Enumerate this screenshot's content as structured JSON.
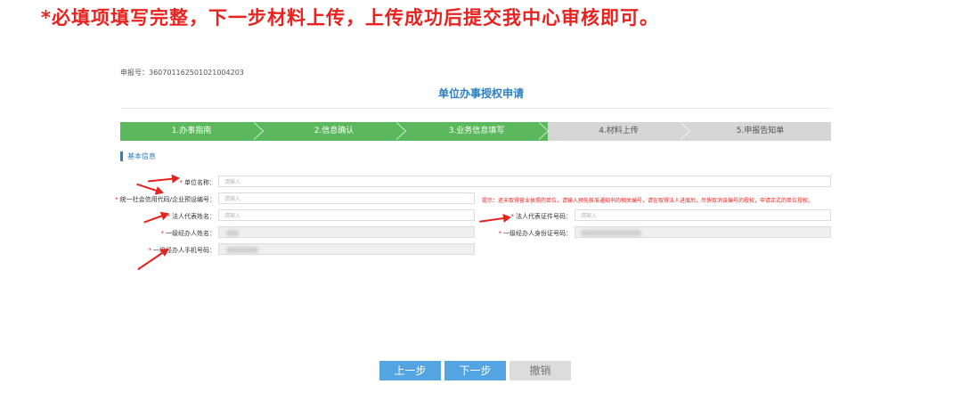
{
  "banner": "*必填项填写完整，下一步材料上传，上传成功后提交我中心审核即可。",
  "application_number": "申报号：36070116250102100420​3",
  "page_title": "单位办事授权申请",
  "steps": [
    {
      "label": "1.办事指南",
      "state": "done"
    },
    {
      "label": "2.信息确认",
      "state": "done"
    },
    {
      "label": "3.业务信息填写",
      "state": "done"
    },
    {
      "label": "4.材料上传",
      "state": "todo"
    },
    {
      "label": "5.申报告知单",
      "state": "todo"
    }
  ],
  "section_title": "基本信息",
  "form": {
    "unit_name": {
      "label": "单位名称：",
      "placeholder": "请输入"
    },
    "credit_code": {
      "label": "统一社会信用代码/企业预设编号：",
      "placeholder": "请输入"
    },
    "credit_hint": "提示：还未取得营业执照的单位，请输入预先核准通知书的相关编号，请在取得法人进度后，尽快取消该编号的授权，申请正式的单位授权。",
    "legal_rep_name": {
      "label": "法人代表姓名：",
      "placeholder": "请输入"
    },
    "legal_rep_id": {
      "label": "法人代表证件号码：",
      "placeholder": "请输入"
    },
    "agent_name": {
      "label": "一级经办人姓名："
    },
    "agent_id": {
      "label": "一级经办人身份证号码："
    },
    "agent_phone": {
      "label": "一级经办人手机号码："
    }
  },
  "buttons": {
    "prev": "上一步",
    "next": "下一步",
    "cancel": "撤销"
  },
  "colors": {
    "done": "#5cb85c",
    "todo": "#d6d6d6",
    "primary": "#2e7fc1",
    "button": "#54a4e1",
    "alert": "#e8231f"
  }
}
